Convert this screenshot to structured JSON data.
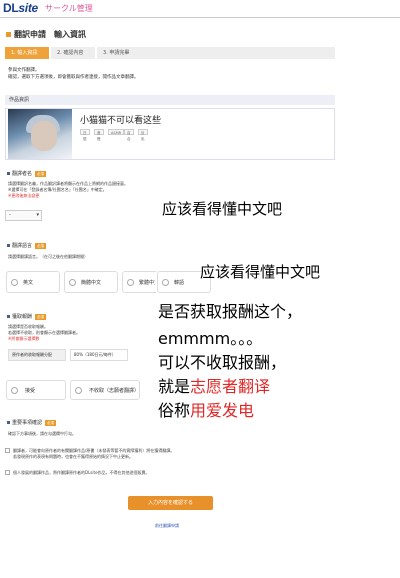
{
  "header": {
    "logo_dl": "DL",
    "logo_site": "site",
    "circle_label": "サークル管理"
  },
  "page": {
    "title": "翻訳申請　輸入資訊"
  },
  "steps": [
    {
      "label": "1. 輸入資訊",
      "active": true
    },
    {
      "label": "2. 確認內容",
      "active": false
    },
    {
      "label": "3. 申請完畢",
      "active": false
    }
  ],
  "intro": {
    "line1": "參與文作翻譯。",
    "line2": "確認，選取下方選項後，即會獲取與作者連接，開作品文章翻譯。"
  },
  "work_section": {
    "label": "作品資訊",
    "title": "小猫猫不可以看这些",
    "tags": [
      "日語",
      "音聲",
      "ASMR",
      "百合",
      "巨乳"
    ]
  },
  "translator": {
    "title": "翻譯者名",
    "badge": "必須",
    "note1": "請選擇翻訳名義，作品翻訳譯者將顯示在作品上將網的作品鏈接裏。",
    "note2": "※選擇可在「登錄者名簿/社團名名」「社團名」中確定。",
    "note3": "※更改後無法變更",
    "select_value": "-"
  },
  "language": {
    "title": "翻譯語言",
    "badge": "必須",
    "note": "請選擇翻譯語言。（在可之後在他翻譯期間）",
    "options": [
      "英文",
      "簡體中文",
      "繁體中文",
      "韓語"
    ]
  },
  "reward": {
    "title": "獲取報酬",
    "badge": "必須",
    "note1": "請選擇是否收取報酬。",
    "note2": "若選擇不收取，則會顯示在選擇翻譯者。",
    "note3": "※將會顯示選擇數",
    "label": "原作者的收取報酬分配",
    "value": "80%（180日元/每件）",
    "options": [
      "接受",
      "不收取（志願者翻譯）"
    ]
  },
  "confirm": {
    "title": "重要事項確認",
    "badge": "必須",
    "note": "確認下方事項後，請在勾選欄中打勾。",
    "check1_a": "翻譯者，可能會向原作者的有關翻譯作品/原書（未發表等暫不的實際獲利）將在獲得翻譯。",
    "check1_b": "若發現原作的表現有問題時，也會在不獲得原始的情況下中止更新。",
    "check2": "個人發展的翻譯作品，將作翻譯原作者的DLsite作品，不得在其他途徑販賣。"
  },
  "actions": {
    "submit": "入力內容を確認する",
    "back": "前往翻譯申請"
  },
  "overlay": {
    "line_a": "应该看得懂中文吧",
    "line_b": "应该看得懂中文吧",
    "line_c": "是否获取报酬这个，",
    "line_d": "emmmm。。。",
    "line_e": "可以不收取报酬，",
    "line_f_pre": "就是",
    "line_f_hl": "志愿者翻译",
    "line_g_pre": "俗称",
    "line_g_hl": "用爱发电"
  }
}
